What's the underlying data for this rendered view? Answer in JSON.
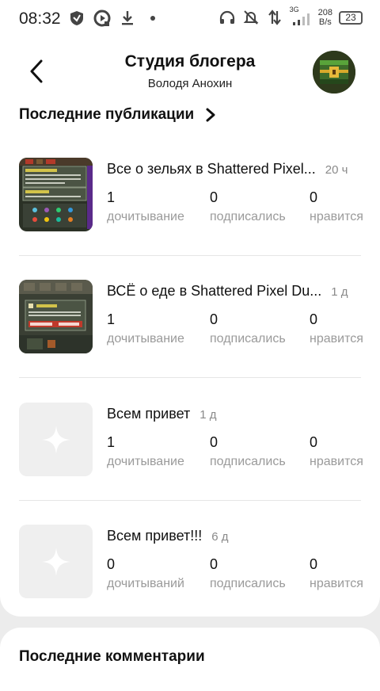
{
  "status_bar": {
    "time": "08:32",
    "network": "3G",
    "speed_value": "208",
    "speed_unit": "B/s",
    "battery": "23",
    "icons_left": [
      "shield-icon",
      "media-icon",
      "download-icon",
      "dot-icon"
    ],
    "icons_right": [
      "headphones-icon",
      "bell-muted-icon",
      "data-arrows-icon",
      "signal-icon"
    ]
  },
  "header": {
    "title": "Студия блогера",
    "subtitle": "Володя Анохин"
  },
  "publications_section": {
    "title": "Последние публикации",
    "items": [
      {
        "title": "Все о зельях в Shattered Pixel...",
        "time": "20 ч",
        "thumb": "game-screenshot",
        "stats": [
          {
            "value": "1",
            "label": "дочитывание"
          },
          {
            "value": "0",
            "label": "подписались"
          },
          {
            "value": "0",
            "label": "нравится"
          }
        ]
      },
      {
        "title": "ВСЁ о еде в Shattered Pixel Du...",
        "time": "1 д",
        "thumb": "game-screenshot",
        "stats": [
          {
            "value": "1",
            "label": "дочитывание"
          },
          {
            "value": "0",
            "label": "подписались"
          },
          {
            "value": "0",
            "label": "нравится"
          }
        ]
      },
      {
        "title": "Всем привет",
        "time": "1 д",
        "thumb": "placeholder",
        "stats": [
          {
            "value": "1",
            "label": "дочитывание"
          },
          {
            "value": "0",
            "label": "подписались"
          },
          {
            "value": "0",
            "label": "нравится"
          }
        ]
      },
      {
        "title": "Всем привет!!!",
        "time": "6 д",
        "thumb": "placeholder",
        "stats": [
          {
            "value": "0",
            "label": "дочитываний"
          },
          {
            "value": "0",
            "label": "подписались"
          },
          {
            "value": "0",
            "label": "нравится"
          }
        ]
      }
    ]
  },
  "comments_section": {
    "title": "Последние комментарии"
  },
  "colors": {
    "background": "#ececec",
    "card": "#ffffff",
    "muted_text": "#9a9a9a",
    "thumb_placeholder": "#efefef"
  }
}
